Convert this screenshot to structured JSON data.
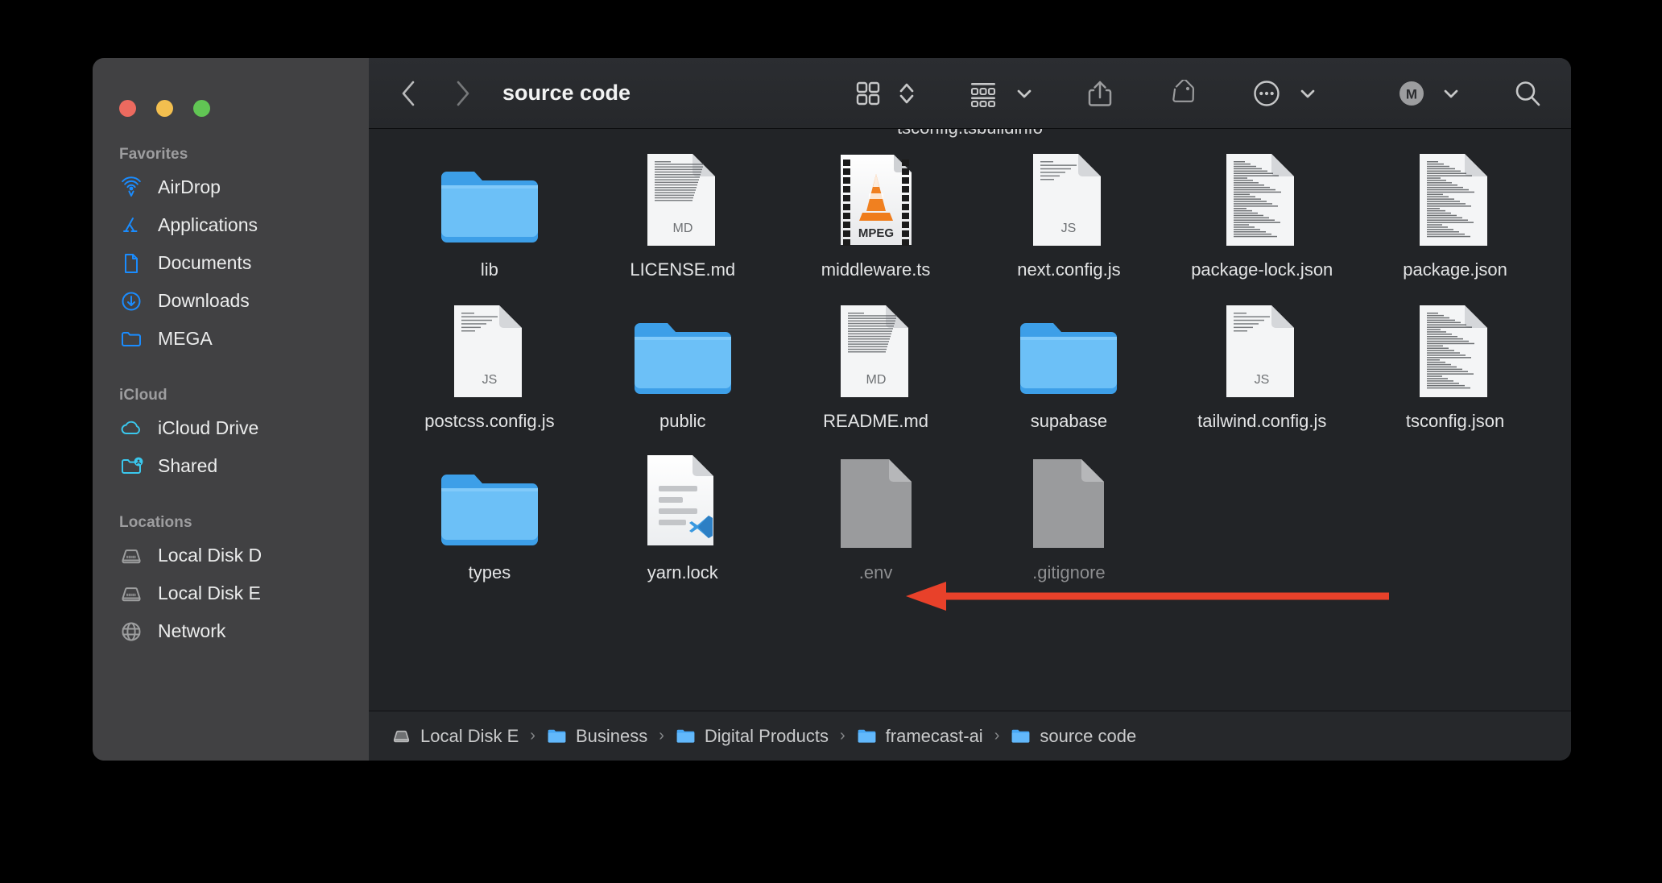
{
  "window": {
    "title": "source code",
    "traffic_lights": [
      {
        "name": "close",
        "color": "#ec6a5f"
      },
      {
        "name": "minimize",
        "color": "#f3bf4f"
      },
      {
        "name": "maximize",
        "color": "#61c554"
      }
    ]
  },
  "toolbar": {
    "back_label": "Back",
    "forward_label": "Forward",
    "title": "source code",
    "view_icon": "grid-view-icon",
    "sort_icon": "sort-chevrons-icon",
    "group_icon": "group-by-icon",
    "group_chevron": "chevron-down-icon",
    "share_icon": "share-icon",
    "tag_icon": "tag-icon",
    "more_icon": "more-ellipsis-icon",
    "more_chevron": "chevron-down-icon",
    "mega_badge": "M",
    "mega_chevron": "chevron-down-icon",
    "search_icon": "search-icon"
  },
  "sidebar": {
    "sections": [
      {
        "title": "Favorites",
        "items": [
          {
            "label": "AirDrop",
            "icon": "airdrop-icon"
          },
          {
            "label": "Applications",
            "icon": "applications-icon"
          },
          {
            "label": "Documents",
            "icon": "document-icon"
          },
          {
            "label": "Downloads",
            "icon": "downloads-icon"
          },
          {
            "label": "MEGA",
            "icon": "folder-icon"
          }
        ]
      },
      {
        "title": "iCloud",
        "items": [
          {
            "label": "iCloud Drive",
            "icon": "cloud-icon"
          },
          {
            "label": "Shared",
            "icon": "shared-folder-icon"
          }
        ]
      },
      {
        "title": "Locations",
        "items": [
          {
            "label": "Local Disk D",
            "icon": "hard-disk-icon"
          },
          {
            "label": "Local Disk E",
            "icon": "hard-disk-icon"
          },
          {
            "label": "Network",
            "icon": "network-globe-icon"
          }
        ]
      }
    ]
  },
  "content": {
    "clipped_top_label": "tsconfig.tsbuildinfo",
    "files": [
      {
        "name": "lib",
        "type": "folder",
        "icon": "blue-folder-icon",
        "dimmed": false
      },
      {
        "name": "LICENSE.md",
        "type": "document",
        "icon": "md-document-icon",
        "badge": "MD",
        "dimmed": false
      },
      {
        "name": "middleware.ts",
        "type": "media",
        "icon": "vlc-mpeg-icon",
        "badge": "MPEG",
        "dimmed": false
      },
      {
        "name": "next.config.js",
        "type": "document",
        "icon": "js-document-icon",
        "badge": "JS",
        "dimmed": false
      },
      {
        "name": "package-lock.json",
        "type": "document",
        "icon": "code-document-icon",
        "dimmed": false
      },
      {
        "name": "package.json",
        "type": "document",
        "icon": "code-document-icon",
        "dimmed": false
      },
      {
        "name": "postcss.config.js",
        "type": "document",
        "icon": "js-document-icon",
        "badge": "JS",
        "dimmed": false
      },
      {
        "name": "public",
        "type": "folder",
        "icon": "blue-folder-icon",
        "dimmed": false
      },
      {
        "name": "README.md",
        "type": "document",
        "icon": "md-document-icon",
        "badge": "MD",
        "dimmed": false
      },
      {
        "name": "supabase",
        "type": "folder",
        "icon": "blue-folder-icon",
        "dimmed": false
      },
      {
        "name": "tailwind.config.js",
        "type": "document",
        "icon": "js-document-icon",
        "badge": "JS",
        "dimmed": false
      },
      {
        "name": "tsconfig.json",
        "type": "document",
        "icon": "code-document-icon",
        "dimmed": false
      },
      {
        "name": "types",
        "type": "folder",
        "icon": "blue-folder-icon",
        "dimmed": false
      },
      {
        "name": "yarn.lock",
        "type": "document",
        "icon": "vscode-document-icon",
        "dimmed": false
      },
      {
        "name": ".env",
        "type": "hidden-file",
        "icon": "gray-document-icon",
        "dimmed": true
      },
      {
        "name": ".gitignore",
        "type": "hidden-file",
        "icon": "gray-document-icon",
        "dimmed": true
      }
    ]
  },
  "pathbar": {
    "crumbs": [
      {
        "label": "Local Disk E",
        "icon": "hard-disk-icon"
      },
      {
        "label": "Business",
        "icon": "folder-icon"
      },
      {
        "label": "Digital Products",
        "icon": "folder-icon"
      },
      {
        "label": "framecast-ai",
        "icon": "folder-icon"
      },
      {
        "label": "source code",
        "icon": "folder-icon"
      }
    ],
    "separator": "›"
  },
  "annotation": {
    "arrow_color": "#e8412a",
    "arrow_name": "red-pointer-arrow"
  },
  "colors": {
    "accent_blue": "#1a8cff",
    "cyan": "#3ac8ee",
    "window_bg": "#222427",
    "sidebar_bg": "#414143"
  }
}
